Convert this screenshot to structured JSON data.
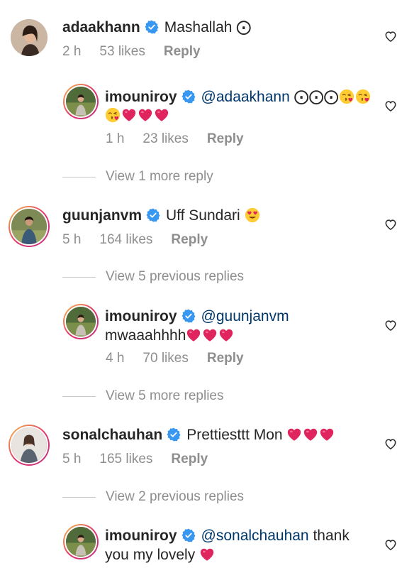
{
  "icons": {
    "verified": "verified-badge-icon",
    "like": "heart-outline-icon",
    "red_heart": "red-heart-emoji",
    "kiss": "kissing-face-emoji",
    "heart_eyes": "heart-eyes-emoji"
  },
  "colors": {
    "verified": "#3897f0",
    "mention": "#00376b",
    "meta": "#8e8e8e",
    "heart": "#e0245e"
  },
  "thread1": {
    "comment": {
      "username": "adaakhann",
      "text": "Mashallah ⨀",
      "time": "2 h",
      "likes": "53 likes",
      "reply": "Reply"
    },
    "reply": {
      "username": "imouniroy",
      "mention": "@adaakhann",
      "extra": "⨀⨀⨀",
      "time": "1 h",
      "likes": "23 likes",
      "reply_label": "Reply"
    },
    "view_more": "View 1 more reply"
  },
  "thread2": {
    "comment": {
      "username": "guunjanvm",
      "text": "Uff Sundari",
      "time": "5 h",
      "likes": "164 likes",
      "reply": "Reply"
    },
    "view_previous": "View 5 previous replies",
    "reply": {
      "username": "imouniroy",
      "mention": "@guunjanvm",
      "text": "mwaaahhhh",
      "time": "4 h",
      "likes": "70 likes",
      "reply_label": "Reply"
    },
    "view_more": "View 5 more replies"
  },
  "thread3": {
    "comment": {
      "username": "sonalchauhan",
      "text": "Prettiesttt Mon",
      "time": "5 h",
      "likes": "165 likes",
      "reply": "Reply"
    },
    "view_previous": "View 2 previous replies",
    "reply": {
      "username": "imouniroy",
      "mention": "@sonalchauhan",
      "text": "thank",
      "text2": "you my lovely"
    }
  }
}
